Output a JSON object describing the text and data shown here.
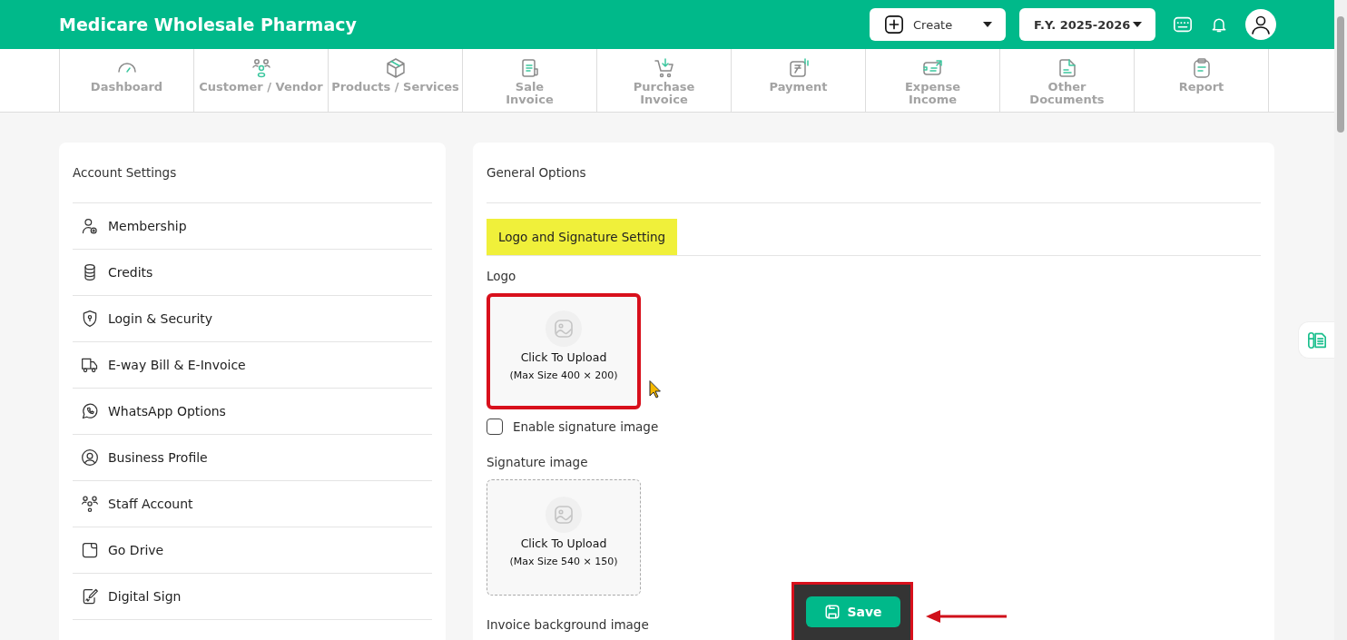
{
  "header": {
    "title": "Medicare Wholesale Pharmacy",
    "create_button": {
      "label": "Create"
    },
    "year_select": {
      "value": "F.Y. 2025-2026"
    }
  },
  "nav": [
    {
      "label": "Dashboard",
      "kind": "gauge"
    },
    {
      "label": "Customer / Vendor",
      "kind": "people"
    },
    {
      "label": "Products / Services",
      "kind": "box"
    },
    {
      "label": "Sale\nInvoice",
      "kind": "receipt"
    },
    {
      "label": "Purchase\nInvoice",
      "kind": "cart"
    },
    {
      "label": "Payment",
      "kind": "rupee"
    },
    {
      "label": "Expense\nIncome",
      "kind": "cash"
    },
    {
      "label": "Other\nDocuments",
      "kind": "document"
    },
    {
      "label": "Report",
      "kind": "clipboard"
    }
  ],
  "sidebar": {
    "title": "Account Settings",
    "items": [
      {
        "label": "Membership",
        "kind": "user-plus"
      },
      {
        "label": "Credits",
        "kind": "coins"
      },
      {
        "label": "Login & Security",
        "kind": "shield"
      },
      {
        "label": "E-way Bill & E-Invoice",
        "kind": "truck"
      },
      {
        "label": "WhatsApp Options",
        "kind": "chat"
      },
      {
        "label": "Business Profile",
        "kind": "user-circle"
      },
      {
        "label": "Staff Account",
        "kind": "people"
      },
      {
        "label": "Go Drive",
        "kind": "folder"
      },
      {
        "label": "Digital Sign",
        "kind": "sign"
      }
    ]
  },
  "main": {
    "title": "General Options",
    "section": {
      "label": "Logo and Signature Setting",
      "highlighted": true
    },
    "fields": [
      {
        "kind": "upload",
        "label": "Logo",
        "text": "Click To Upload",
        "hint": "(Max Size 400 × 200)",
        "highlighted": true,
        "dashed": false
      },
      {
        "kind": "checkbox",
        "label": "Enable signature image",
        "checked": false
      },
      {
        "kind": "upload",
        "label": "Signature image",
        "text": "Click To Upload",
        "hint": "(Max Size 540 × 150)",
        "highlighted": false,
        "dashed": true
      },
      {
        "kind": "label",
        "label": "Invoice background image"
      }
    ]
  },
  "save": {
    "label": "Save",
    "highlighted": true,
    "pointer_arrow": true
  }
}
